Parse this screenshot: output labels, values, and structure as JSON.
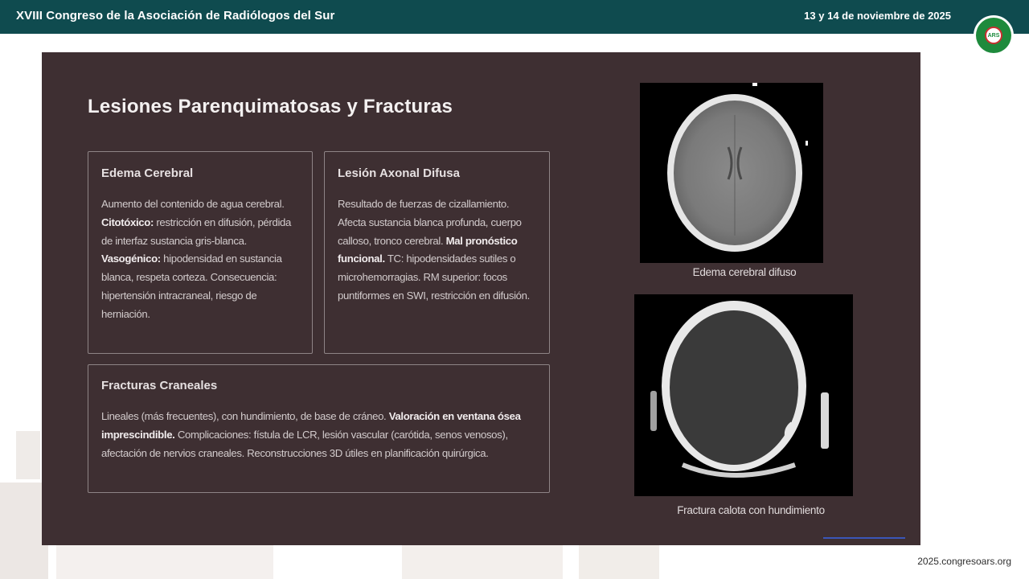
{
  "header": {
    "title": "XVIII Congreso de la Asociación de Radiólogos del Sur",
    "date": "13 y 14 de noviembre de 2025",
    "logo_text": "ARS"
  },
  "slide": {
    "title": "Lesiones Parenquimatosas y Fracturas",
    "cards": [
      {
        "heading": "Edema Cerebral",
        "parts": [
          {
            "t": "Aumento del contenido de agua cerebral. "
          },
          {
            "t": "Citotóxico:",
            "b": true
          },
          {
            "t": " restricción en difusión, pérdida de interfaz sustancia gris-blanca. "
          },
          {
            "t": "Vasogénico:",
            "b": true
          },
          {
            "t": " hipodensidad en sustancia blanca, respeta corteza. Consecuencia: hipertensión intracraneal, riesgo de herniación."
          }
        ]
      },
      {
        "heading": "Lesión Axonal Difusa",
        "parts": [
          {
            "t": "Resultado de fuerzas de cizallamiento. Afecta sustancia blanca profunda, cuerpo calloso, tronco cerebral. "
          },
          {
            "t": "Mal pronóstico funcional.",
            "b": true
          },
          {
            "t": " TC: hipodensidades sutiles o microhemorragias. RM superior: focos puntiformes en SWI, restricción en difusión."
          }
        ]
      },
      {
        "heading": "Fracturas Craneales",
        "parts": [
          {
            "t": "Lineales (más frecuentes), con hundimiento, de base de cráneo. "
          },
          {
            "t": "Valoración en ventana ósea imprescindible.",
            "b": true
          },
          {
            "t": " Complicaciones: fístula de LCR, lesión vascular (carótida, senos venosos), afectación de nervios craneales. Reconstrucciones 3D útiles en planificación quirúrgica."
          }
        ]
      }
    ],
    "images": [
      {
        "caption": "Edema cerebral difuso"
      },
      {
        "caption": "Fractura calota con hundimiento"
      }
    ]
  },
  "footer": {
    "url": "2025.congresoars.org"
  }
}
